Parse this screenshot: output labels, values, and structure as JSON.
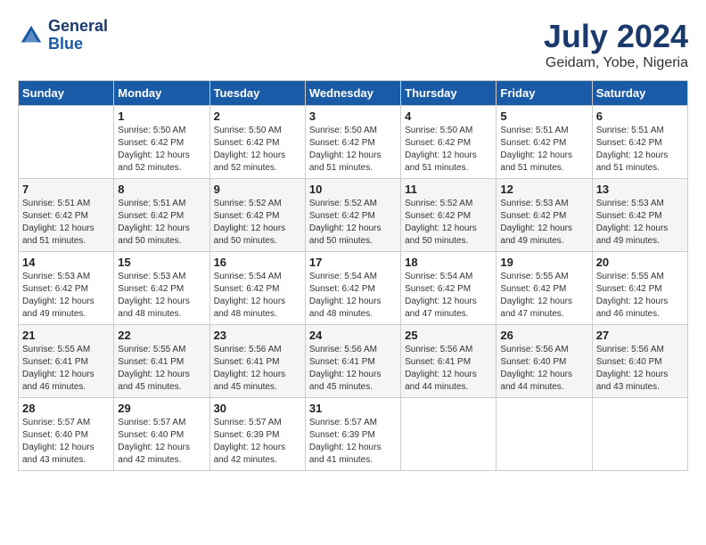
{
  "header": {
    "logo_general": "General",
    "logo_blue": "Blue",
    "month": "July 2024",
    "location": "Geidam, Yobe, Nigeria"
  },
  "days_of_week": [
    "Sunday",
    "Monday",
    "Tuesday",
    "Wednesday",
    "Thursday",
    "Friday",
    "Saturday"
  ],
  "weeks": [
    [
      {
        "day": "",
        "info": ""
      },
      {
        "day": "1",
        "info": "Sunrise: 5:50 AM\nSunset: 6:42 PM\nDaylight: 12 hours\nand 52 minutes."
      },
      {
        "day": "2",
        "info": "Sunrise: 5:50 AM\nSunset: 6:42 PM\nDaylight: 12 hours\nand 52 minutes."
      },
      {
        "day": "3",
        "info": "Sunrise: 5:50 AM\nSunset: 6:42 PM\nDaylight: 12 hours\nand 51 minutes."
      },
      {
        "day": "4",
        "info": "Sunrise: 5:50 AM\nSunset: 6:42 PM\nDaylight: 12 hours\nand 51 minutes."
      },
      {
        "day": "5",
        "info": "Sunrise: 5:51 AM\nSunset: 6:42 PM\nDaylight: 12 hours\nand 51 minutes."
      },
      {
        "day": "6",
        "info": "Sunrise: 5:51 AM\nSunset: 6:42 PM\nDaylight: 12 hours\nand 51 minutes."
      }
    ],
    [
      {
        "day": "7",
        "info": "Sunrise: 5:51 AM\nSunset: 6:42 PM\nDaylight: 12 hours\nand 51 minutes."
      },
      {
        "day": "8",
        "info": "Sunrise: 5:51 AM\nSunset: 6:42 PM\nDaylight: 12 hours\nand 50 minutes."
      },
      {
        "day": "9",
        "info": "Sunrise: 5:52 AM\nSunset: 6:42 PM\nDaylight: 12 hours\nand 50 minutes."
      },
      {
        "day": "10",
        "info": "Sunrise: 5:52 AM\nSunset: 6:42 PM\nDaylight: 12 hours\nand 50 minutes."
      },
      {
        "day": "11",
        "info": "Sunrise: 5:52 AM\nSunset: 6:42 PM\nDaylight: 12 hours\nand 50 minutes."
      },
      {
        "day": "12",
        "info": "Sunrise: 5:53 AM\nSunset: 6:42 PM\nDaylight: 12 hours\nand 49 minutes."
      },
      {
        "day": "13",
        "info": "Sunrise: 5:53 AM\nSunset: 6:42 PM\nDaylight: 12 hours\nand 49 minutes."
      }
    ],
    [
      {
        "day": "14",
        "info": "Sunrise: 5:53 AM\nSunset: 6:42 PM\nDaylight: 12 hours\nand 49 minutes."
      },
      {
        "day": "15",
        "info": "Sunrise: 5:53 AM\nSunset: 6:42 PM\nDaylight: 12 hours\nand 48 minutes."
      },
      {
        "day": "16",
        "info": "Sunrise: 5:54 AM\nSunset: 6:42 PM\nDaylight: 12 hours\nand 48 minutes."
      },
      {
        "day": "17",
        "info": "Sunrise: 5:54 AM\nSunset: 6:42 PM\nDaylight: 12 hours\nand 48 minutes."
      },
      {
        "day": "18",
        "info": "Sunrise: 5:54 AM\nSunset: 6:42 PM\nDaylight: 12 hours\nand 47 minutes."
      },
      {
        "day": "19",
        "info": "Sunrise: 5:55 AM\nSunset: 6:42 PM\nDaylight: 12 hours\nand 47 minutes."
      },
      {
        "day": "20",
        "info": "Sunrise: 5:55 AM\nSunset: 6:42 PM\nDaylight: 12 hours\nand 46 minutes."
      }
    ],
    [
      {
        "day": "21",
        "info": "Sunrise: 5:55 AM\nSunset: 6:41 PM\nDaylight: 12 hours\nand 46 minutes."
      },
      {
        "day": "22",
        "info": "Sunrise: 5:55 AM\nSunset: 6:41 PM\nDaylight: 12 hours\nand 45 minutes."
      },
      {
        "day": "23",
        "info": "Sunrise: 5:56 AM\nSunset: 6:41 PM\nDaylight: 12 hours\nand 45 minutes."
      },
      {
        "day": "24",
        "info": "Sunrise: 5:56 AM\nSunset: 6:41 PM\nDaylight: 12 hours\nand 45 minutes."
      },
      {
        "day": "25",
        "info": "Sunrise: 5:56 AM\nSunset: 6:41 PM\nDaylight: 12 hours\nand 44 minutes."
      },
      {
        "day": "26",
        "info": "Sunrise: 5:56 AM\nSunset: 6:40 PM\nDaylight: 12 hours\nand 44 minutes."
      },
      {
        "day": "27",
        "info": "Sunrise: 5:56 AM\nSunset: 6:40 PM\nDaylight: 12 hours\nand 43 minutes."
      }
    ],
    [
      {
        "day": "28",
        "info": "Sunrise: 5:57 AM\nSunset: 6:40 PM\nDaylight: 12 hours\nand 43 minutes."
      },
      {
        "day": "29",
        "info": "Sunrise: 5:57 AM\nSunset: 6:40 PM\nDaylight: 12 hours\nand 42 minutes."
      },
      {
        "day": "30",
        "info": "Sunrise: 5:57 AM\nSunset: 6:39 PM\nDaylight: 12 hours\nand 42 minutes."
      },
      {
        "day": "31",
        "info": "Sunrise: 5:57 AM\nSunset: 6:39 PM\nDaylight: 12 hours\nand 41 minutes."
      },
      {
        "day": "",
        "info": ""
      },
      {
        "day": "",
        "info": ""
      },
      {
        "day": "",
        "info": ""
      }
    ]
  ]
}
